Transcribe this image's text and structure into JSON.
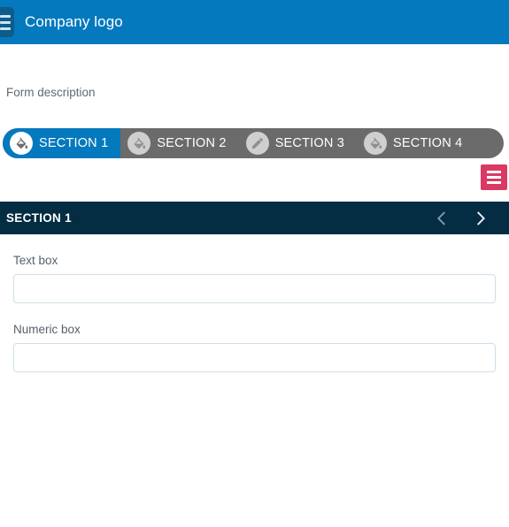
{
  "appbar": {
    "menu_icon": "hamburger-menu-icon",
    "title": "Company logo",
    "background_color": "#0579be"
  },
  "clipped_text": "",
  "form": {
    "description": "Form description"
  },
  "tabs": {
    "active_index": 0,
    "items": [
      {
        "label": "SECTION 1",
        "icon": "paint-bucket-icon",
        "active": true
      },
      {
        "label": "SECTION 2",
        "icon": "paint-bucket-icon",
        "active": false
      },
      {
        "label": "SECTION 3",
        "icon": "pencil-icon",
        "active": false
      },
      {
        "label": "SECTION 4",
        "icon": "paint-bucket-icon",
        "active": false
      }
    ],
    "active_color": "#0579be",
    "inactive_color": "#6b6b6b"
  },
  "menu_button": {
    "icon": "hamburger-menu-icon",
    "color": "#d93963"
  },
  "section_header": {
    "title": "SECTION 1",
    "background_color": "#042c42",
    "prev_icon": "chevron-left-icon",
    "next_icon": "chevron-right-icon"
  },
  "fields": [
    {
      "label": "Text box",
      "value": "",
      "placeholder": "",
      "type": "text"
    },
    {
      "label": "Numeric box",
      "value": "",
      "placeholder": "",
      "type": "number"
    }
  ]
}
